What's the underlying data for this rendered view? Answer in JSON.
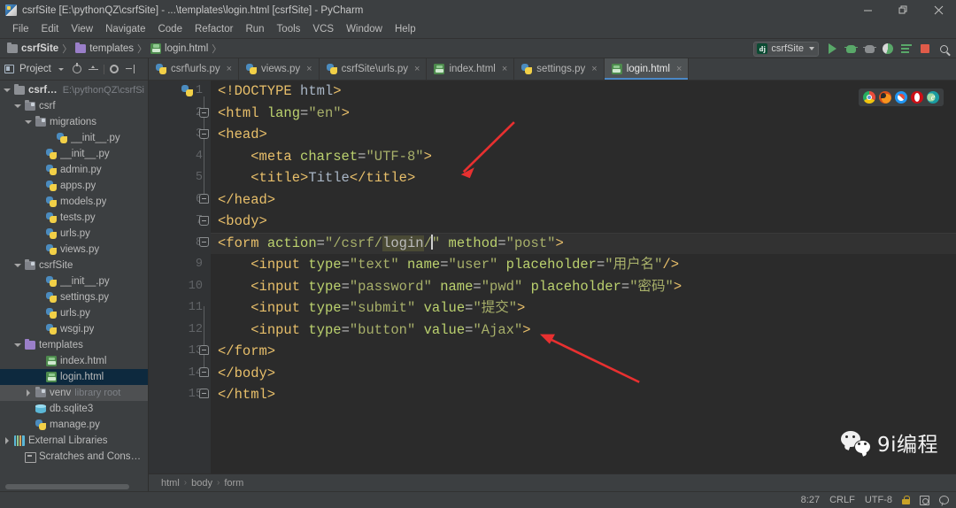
{
  "window": {
    "title": "csrfSite [E:\\pythonQZ\\csrfSite] - ...\\templates\\login.html [csrfSite] - PyCharm",
    "app_icon": "pycharm-icon",
    "controls": {
      "minimize": "minimize-button",
      "restore": "restore-button",
      "close": "close-button"
    }
  },
  "menubar": {
    "items": [
      "File",
      "Edit",
      "View",
      "Navigate",
      "Code",
      "Refactor",
      "Run",
      "Tools",
      "VCS",
      "Window",
      "Help"
    ]
  },
  "navbar": {
    "crumbs": [
      {
        "label": "csrfSite",
        "icon": "folder-icon",
        "bold": true
      },
      {
        "label": "templates",
        "icon": "folder-purple-icon",
        "bold": false
      },
      {
        "label": "login.html",
        "icon": "html-file-icon",
        "bold": false
      }
    ],
    "separator": "〉",
    "run_config": {
      "label": "csrfSite",
      "icon": "django-icon",
      "dropdown": "chevron-down-icon"
    },
    "buttons": [
      {
        "name": "run-button",
        "icon": "play-icon"
      },
      {
        "name": "debug-button",
        "icon": "bug-icon"
      },
      {
        "name": "run-with-coverage-button",
        "icon": "bug-gray-icon"
      },
      {
        "name": "coverage-button",
        "icon": "coverage-icon"
      },
      {
        "name": "profile-button",
        "icon": "flow-icon"
      },
      {
        "name": "stop-button",
        "icon": "stop-icon"
      },
      {
        "name": "search-everywhere-button",
        "icon": "search-icon"
      }
    ]
  },
  "sidebar": {
    "title": "Project",
    "toolbar": [
      {
        "name": "project-scope-dropdown",
        "icon": "chevron-down-icon"
      },
      {
        "name": "scroll-from-source-button",
        "icon": "target-icon"
      },
      {
        "name": "collapse-all-button",
        "icon": "collapse-all-icon"
      },
      {
        "name": "settings-button",
        "icon": "gear-icon"
      },
      {
        "name": "hide-panel-button",
        "icon": "hide-panel-icon"
      }
    ],
    "tree": [
      {
        "label": "csrfSite",
        "sub": "E:\\pythonQZ\\csrfSi",
        "indent": 0,
        "icon": "folder-icon",
        "toggle": "down",
        "bold": true,
        "state": "normal"
      },
      {
        "label": "csrf",
        "sub": "",
        "indent": 1,
        "icon": "folder-module-icon",
        "toggle": "down",
        "bold": false,
        "state": "normal"
      },
      {
        "label": "migrations",
        "sub": "",
        "indent": 2,
        "icon": "folder-module-icon",
        "toggle": "down",
        "bold": false,
        "state": "normal"
      },
      {
        "label": "__init__.py",
        "sub": "",
        "indent": 4,
        "icon": "python-file-icon",
        "toggle": "none",
        "bold": false,
        "state": "normal"
      },
      {
        "label": "__init__.py",
        "sub": "",
        "indent": 3,
        "icon": "python-file-icon",
        "toggle": "none",
        "bold": false,
        "state": "normal"
      },
      {
        "label": "admin.py",
        "sub": "",
        "indent": 3,
        "icon": "python-file-icon",
        "toggle": "none",
        "bold": false,
        "state": "normal"
      },
      {
        "label": "apps.py",
        "sub": "",
        "indent": 3,
        "icon": "python-file-icon",
        "toggle": "none",
        "bold": false,
        "state": "normal"
      },
      {
        "label": "models.py",
        "sub": "",
        "indent": 3,
        "icon": "python-file-icon",
        "toggle": "none",
        "bold": false,
        "state": "normal"
      },
      {
        "label": "tests.py",
        "sub": "",
        "indent": 3,
        "icon": "python-file-icon",
        "toggle": "none",
        "bold": false,
        "state": "normal"
      },
      {
        "label": "urls.py",
        "sub": "",
        "indent": 3,
        "icon": "python-file-icon",
        "toggle": "none",
        "bold": false,
        "state": "normal"
      },
      {
        "label": "views.py",
        "sub": "",
        "indent": 3,
        "icon": "python-file-icon",
        "toggle": "none",
        "bold": false,
        "state": "normal"
      },
      {
        "label": "csrfSite",
        "sub": "",
        "indent": 1,
        "icon": "folder-module-icon",
        "toggle": "down",
        "bold": false,
        "state": "normal"
      },
      {
        "label": "__init__.py",
        "sub": "",
        "indent": 3,
        "icon": "python-file-icon",
        "toggle": "none",
        "bold": false,
        "state": "normal"
      },
      {
        "label": "settings.py",
        "sub": "",
        "indent": 3,
        "icon": "python-file-icon",
        "toggle": "none",
        "bold": false,
        "state": "normal"
      },
      {
        "label": "urls.py",
        "sub": "",
        "indent": 3,
        "icon": "python-file-icon",
        "toggle": "none",
        "bold": false,
        "state": "normal"
      },
      {
        "label": "wsgi.py",
        "sub": "",
        "indent": 3,
        "icon": "python-file-icon",
        "toggle": "none",
        "bold": false,
        "state": "normal"
      },
      {
        "label": "templates",
        "sub": "",
        "indent": 1,
        "icon": "folder-purple-icon",
        "toggle": "down",
        "bold": false,
        "state": "normal"
      },
      {
        "label": "index.html",
        "sub": "",
        "indent": 3,
        "icon": "html-file-icon",
        "toggle": "none",
        "bold": false,
        "state": "normal"
      },
      {
        "label": "login.html",
        "sub": "",
        "indent": 3,
        "icon": "html-file-icon",
        "toggle": "none",
        "bold": false,
        "state": "selected"
      },
      {
        "label": "venv",
        "sub": "library root",
        "indent": 2,
        "icon": "folder-module-icon",
        "toggle": "right",
        "bold": false,
        "state": "focused"
      },
      {
        "label": "db.sqlite3",
        "sub": "",
        "indent": 2,
        "icon": "database-icon",
        "toggle": "none",
        "bold": false,
        "state": "normal"
      },
      {
        "label": "manage.py",
        "sub": "",
        "indent": 2,
        "icon": "python-file-icon",
        "toggle": "none",
        "bold": false,
        "state": "normal"
      },
      {
        "label": "External Libraries",
        "sub": "",
        "indent": 0,
        "icon": "library-icon",
        "toggle": "right",
        "bold": false,
        "state": "normal"
      },
      {
        "label": "Scratches and Consoles",
        "sub": "",
        "indent": 1,
        "icon": "scratch-icon",
        "toggle": "none",
        "bold": false,
        "state": "normal"
      }
    ]
  },
  "tabs": [
    {
      "label": "csrf\\urls.py",
      "icon": "python-file-icon",
      "active": false,
      "close": "×"
    },
    {
      "label": "views.py",
      "icon": "python-file-icon",
      "active": false,
      "close": "×"
    },
    {
      "label": "csrfSite\\urls.py",
      "icon": "python-file-icon",
      "active": false,
      "close": "×"
    },
    {
      "label": "index.html",
      "icon": "html-file-icon",
      "active": false,
      "close": "×"
    },
    {
      "label": "settings.py",
      "icon": "python-file-icon",
      "active": false,
      "close": "×"
    },
    {
      "label": "login.html",
      "icon": "html-file-icon",
      "active": true,
      "close": "×"
    }
  ],
  "editor": {
    "line_numbers": [
      "1",
      "2",
      "3",
      "4",
      "5",
      "6",
      "7",
      "8",
      "9",
      "10",
      "11",
      "12",
      "13",
      "14",
      "15"
    ],
    "current_line": 8,
    "code_lines": [
      {
        "n": 1,
        "tokens": [
          {
            "t": "t",
            "v": "<!DOCTYPE "
          },
          {
            "t": "pl",
            "v": "html"
          },
          {
            "t": "t",
            "v": ">"
          }
        ]
      },
      {
        "n": 2,
        "tokens": [
          {
            "t": "t",
            "v": "<html "
          },
          {
            "t": "a",
            "v": "lang"
          },
          {
            "t": "eq",
            "v": "="
          },
          {
            "t": "s",
            "v": "\"en\""
          },
          {
            "t": "t",
            "v": ">"
          }
        ]
      },
      {
        "n": 3,
        "tokens": [
          {
            "t": "t",
            "v": "<head>"
          }
        ]
      },
      {
        "n": 4,
        "tokens": [
          {
            "t": "pl",
            "v": "    "
          },
          {
            "t": "t",
            "v": "<meta "
          },
          {
            "t": "a",
            "v": "charset"
          },
          {
            "t": "eq",
            "v": "="
          },
          {
            "t": "s",
            "v": "\"UTF-8\""
          },
          {
            "t": "t",
            "v": ">"
          }
        ]
      },
      {
        "n": 5,
        "tokens": [
          {
            "t": "pl",
            "v": "    "
          },
          {
            "t": "t",
            "v": "<title>"
          },
          {
            "t": "pl",
            "v": "Title"
          },
          {
            "t": "t",
            "v": "</title>"
          }
        ]
      },
      {
        "n": 6,
        "tokens": [
          {
            "t": "t",
            "v": "</head>"
          }
        ]
      },
      {
        "n": 7,
        "tokens": [
          {
            "t": "t",
            "v": "<body>"
          }
        ]
      },
      {
        "n": 8,
        "tokens": [
          {
            "t": "t",
            "v": "<form "
          },
          {
            "t": "a",
            "v": "action"
          },
          {
            "t": "eq",
            "v": "="
          },
          {
            "t": "s",
            "v": "\"/csrf/"
          },
          {
            "t": "hl",
            "v": "login"
          },
          {
            "t": "s",
            "v": "/"
          },
          {
            "t": "caret",
            "v": ""
          },
          {
            "t": "s",
            "v": "\""
          },
          {
            "t": "pl",
            "v": " "
          },
          {
            "t": "a",
            "v": "method"
          },
          {
            "t": "eq",
            "v": "="
          },
          {
            "t": "s",
            "v": "\"post\""
          },
          {
            "t": "t",
            "v": ">"
          }
        ]
      },
      {
        "n": 9,
        "tokens": [
          {
            "t": "pl",
            "v": "    "
          },
          {
            "t": "t",
            "v": "<input "
          },
          {
            "t": "a",
            "v": "type"
          },
          {
            "t": "eq",
            "v": "="
          },
          {
            "t": "s",
            "v": "\"text\""
          },
          {
            "t": "pl",
            "v": " "
          },
          {
            "t": "a",
            "v": "name"
          },
          {
            "t": "eq",
            "v": "="
          },
          {
            "t": "s",
            "v": "\"user\""
          },
          {
            "t": "pl",
            "v": " "
          },
          {
            "t": "a",
            "v": "placeholder"
          },
          {
            "t": "eq",
            "v": "="
          },
          {
            "t": "s",
            "v": "\"用户名\""
          },
          {
            "t": "t",
            "v": "/>"
          }
        ]
      },
      {
        "n": 10,
        "tokens": [
          {
            "t": "pl",
            "v": "    "
          },
          {
            "t": "t",
            "v": "<input "
          },
          {
            "t": "a",
            "v": "type"
          },
          {
            "t": "eq",
            "v": "="
          },
          {
            "t": "s",
            "v": "\"password\""
          },
          {
            "t": "pl",
            "v": " "
          },
          {
            "t": "a",
            "v": "name"
          },
          {
            "t": "eq",
            "v": "="
          },
          {
            "t": "s",
            "v": "\"pwd\""
          },
          {
            "t": "pl",
            "v": " "
          },
          {
            "t": "a",
            "v": "placeholder"
          },
          {
            "t": "eq",
            "v": "="
          },
          {
            "t": "s",
            "v": "\"密码\""
          },
          {
            "t": "t",
            "v": ">"
          }
        ]
      },
      {
        "n": 11,
        "tokens": [
          {
            "t": "pl",
            "v": "    "
          },
          {
            "t": "t",
            "v": "<input "
          },
          {
            "t": "a",
            "v": "type"
          },
          {
            "t": "eq",
            "v": "="
          },
          {
            "t": "s",
            "v": "\"submit\""
          },
          {
            "t": "pl",
            "v": " "
          },
          {
            "t": "a",
            "v": "value"
          },
          {
            "t": "eq",
            "v": "="
          },
          {
            "t": "s",
            "v": "\"提交\""
          },
          {
            "t": "t",
            "v": ">"
          }
        ]
      },
      {
        "n": 12,
        "tokens": [
          {
            "t": "pl",
            "v": "    "
          },
          {
            "t": "t",
            "v": "<input "
          },
          {
            "t": "a",
            "v": "type"
          },
          {
            "t": "eq",
            "v": "="
          },
          {
            "t": "s",
            "v": "\"button\""
          },
          {
            "t": "pl",
            "v": " "
          },
          {
            "t": "a",
            "v": "value"
          },
          {
            "t": "eq",
            "v": "="
          },
          {
            "t": "s",
            "v": "\"Ajax\""
          },
          {
            "t": "t",
            "v": ">"
          }
        ]
      },
      {
        "n": 13,
        "tokens": [
          {
            "t": "t",
            "v": "</form>"
          }
        ]
      },
      {
        "n": 14,
        "tokens": [
          {
            "t": "t",
            "v": "</body>"
          }
        ]
      },
      {
        "n": 15,
        "tokens": [
          {
            "t": "t",
            "v": "</html>"
          }
        ]
      }
    ],
    "browser_preview": [
      {
        "name": "chrome-icon",
        "label": ""
      },
      {
        "name": "firefox-icon",
        "label": ""
      },
      {
        "name": "safari-icon",
        "label": ""
      },
      {
        "name": "opera-icon",
        "label": ""
      },
      {
        "name": "edge-icon",
        "label": "e"
      }
    ],
    "annotations": [
      {
        "name": "red-arrow-to-caret",
        "color": "#e83030"
      },
      {
        "name": "red-arrow-to-ajax-line",
        "color": "#e83030"
      }
    ]
  },
  "watermark": {
    "text": "9i编程",
    "logo": "wechat-logo"
  },
  "breadcrumb_strip": {
    "items": [
      "html",
      "body",
      "form"
    ],
    "separator": "›"
  },
  "statusbar": {
    "caret_position": "8:27",
    "line_separator": "CRLF",
    "encoding": "UTF-8",
    "lock": "lock-icon",
    "cursor_tool": "cursor-icon",
    "notifications": "balloon-icon"
  },
  "colors": {
    "chrome_bg": "#3c3f41",
    "editor_bg": "#2b2b2b",
    "gutter_bg": "#313335",
    "tag": "#e8bf6a",
    "attribute": "#bbd16e",
    "string": "#a8b06a",
    "selection": "#0d293e",
    "accent": "#4a88c7",
    "annotation_red": "#e83030"
  }
}
